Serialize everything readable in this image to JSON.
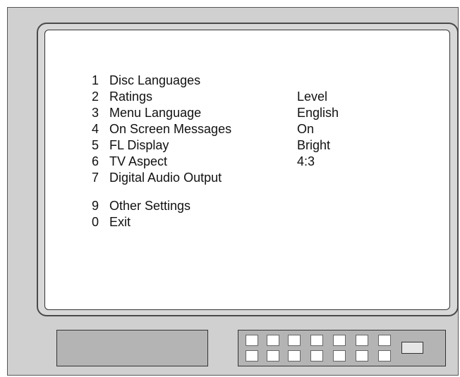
{
  "menu": {
    "items": [
      {
        "number": "1",
        "label": "Disc Languages",
        "value": ""
      },
      {
        "number": "2",
        "label": "Ratings",
        "value": "Level"
      },
      {
        "number": "3",
        "label": "Menu Language",
        "value": "English"
      },
      {
        "number": "4",
        "label": "On Screen Messages",
        "value": "On"
      },
      {
        "number": "5",
        "label": "FL Display",
        "value": "Bright"
      },
      {
        "number": "6",
        "label": "TV Aspect",
        "value": "4:3"
      },
      {
        "number": "7",
        "label": "Digital Audio Output",
        "value": ""
      },
      {
        "number": "9",
        "label": "Other Settings",
        "value": ""
      },
      {
        "number": "0",
        "label": "Exit",
        "value": ""
      }
    ]
  },
  "colors": {
    "tv_body": "#d0d0d0",
    "screen": "#ffffff",
    "panel": "#b4b4b4",
    "text": "#111111"
  }
}
